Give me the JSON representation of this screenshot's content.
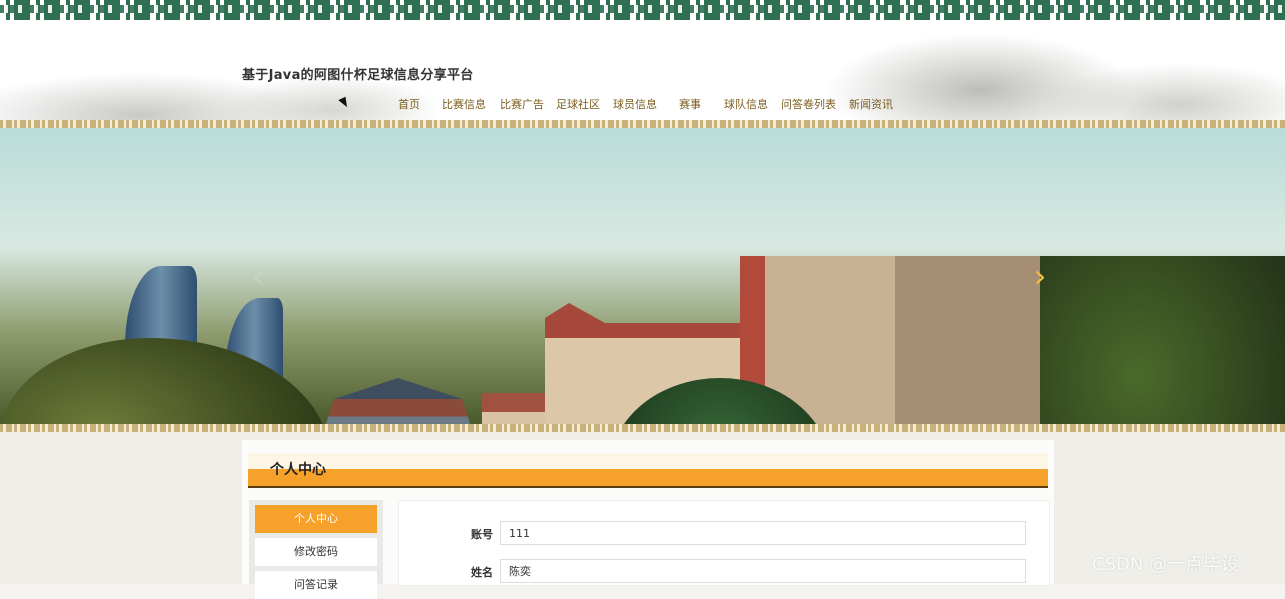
{
  "header": {
    "site_title": "基于Java的阿图什杯足球信息分享平台"
  },
  "nav": {
    "items": [
      {
        "label": "首页",
        "width": 44
      },
      {
        "label": "比赛信息",
        "width": 58
      },
      {
        "label": "比赛广告",
        "width": 56
      },
      {
        "label": "足球社区",
        "width": 57
      },
      {
        "label": "球员信息",
        "width": 60
      },
      {
        "label": "赛事",
        "width": 50
      },
      {
        "label": "球队信息",
        "width": 58
      },
      {
        "label": "问答卷列表",
        "width": 68
      },
      {
        "label": "新闻资讯",
        "width": 50
      }
    ]
  },
  "banner": {
    "prev_glyph": "‹",
    "next_glyph": "›"
  },
  "section": {
    "title": "个人中心"
  },
  "sidebar": {
    "items": [
      {
        "label": "个人中心",
        "active": true
      },
      {
        "label": "修改密码",
        "active": false
      },
      {
        "label": "问答记录",
        "active": false
      }
    ]
  },
  "form": {
    "fields": [
      {
        "label": "账号",
        "value": "111"
      },
      {
        "label": "姓名",
        "value": "陈奕"
      }
    ]
  },
  "watermark": {
    "text": "CSDN @一点毕设"
  },
  "colors": {
    "accent": "#f6a12a",
    "nav_text": "#7a5c1e",
    "border_green": "#2f6f52"
  }
}
